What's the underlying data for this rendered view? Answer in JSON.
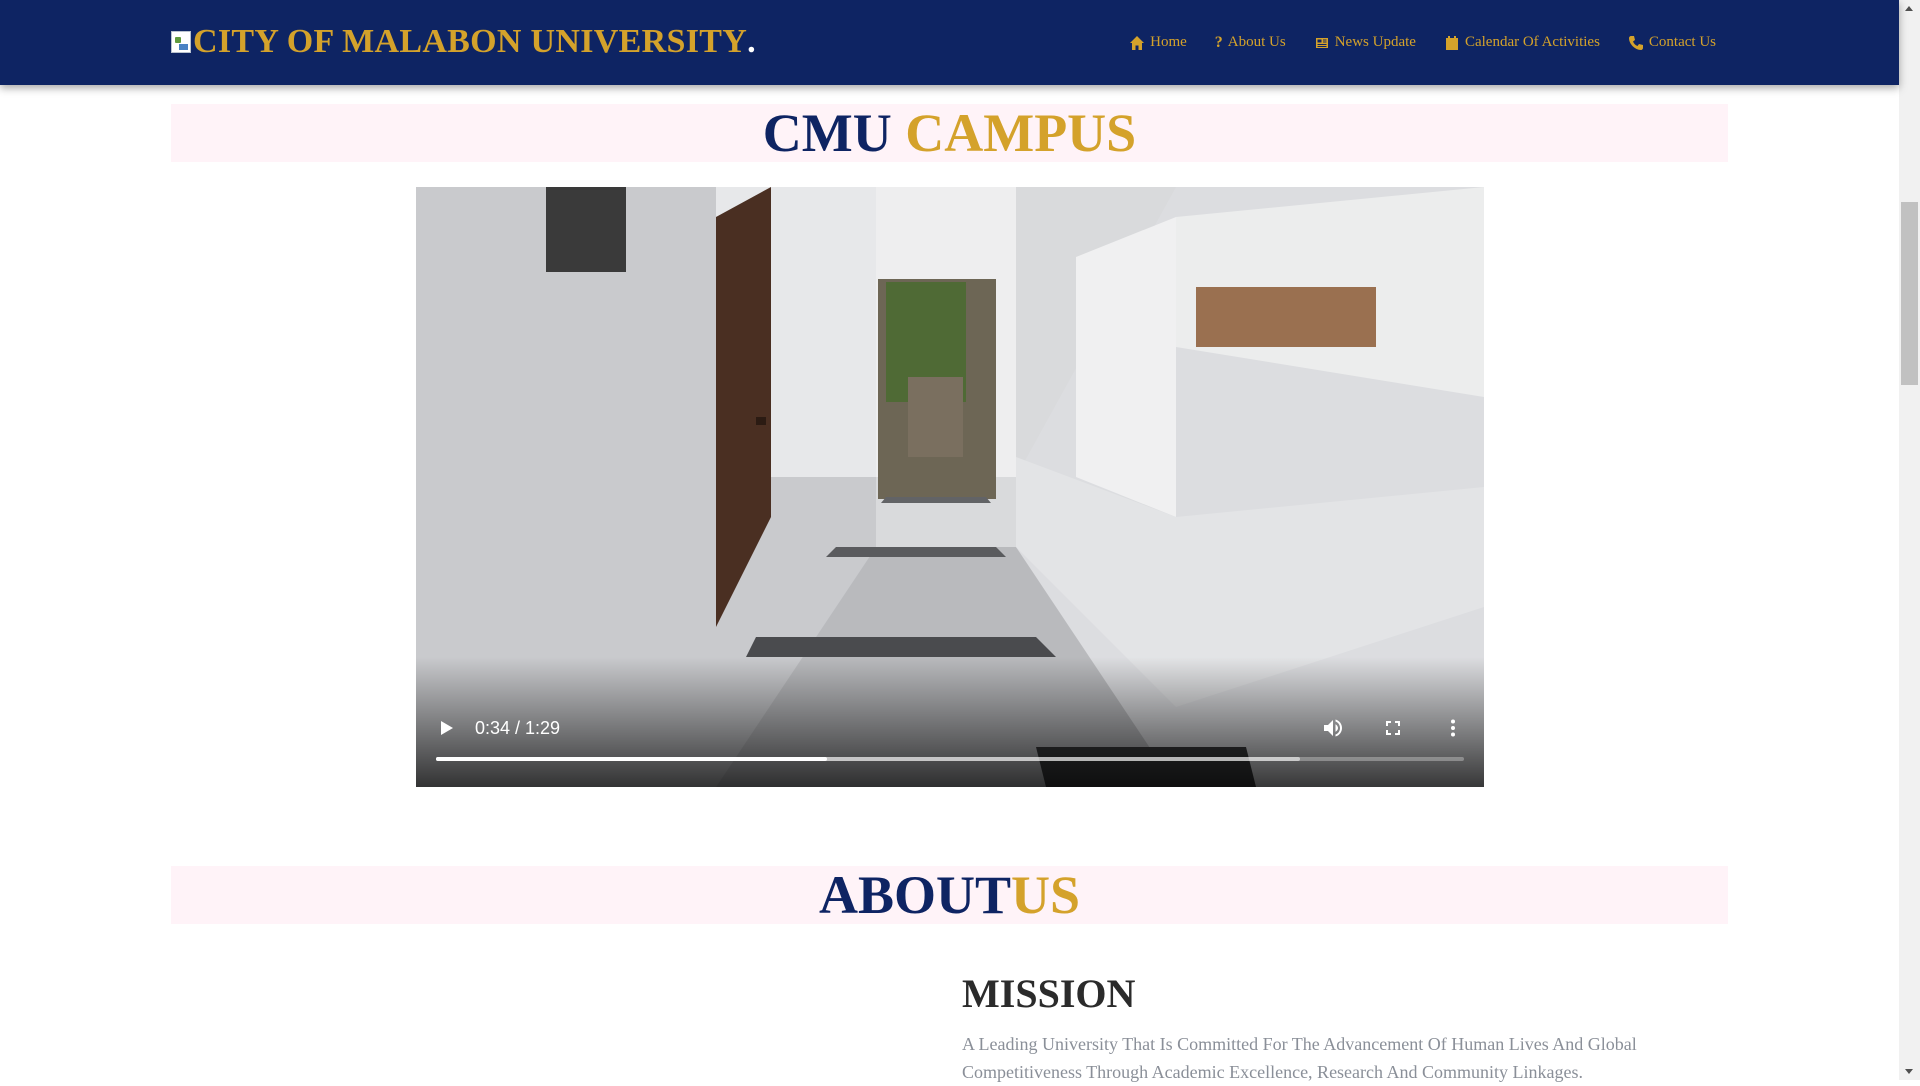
{
  "header": {
    "brand": "CITY OF MALABON UNIVERSITY",
    "brand_dot": ".",
    "nav": [
      {
        "label": "Home",
        "icon": "home-icon"
      },
      {
        "label": "About Us",
        "icon": "question-icon"
      },
      {
        "label": "News Update",
        "icon": "newspaper-icon"
      },
      {
        "label": "Calendar Of Activities",
        "icon": "calendar-icon"
      },
      {
        "label": "Contact Us",
        "icon": "phone-icon"
      }
    ]
  },
  "campus": {
    "title_part1": "CMU",
    "title_part2": "CAMPUS"
  },
  "video": {
    "time": "0:34 / 1:29",
    "played_fraction": 0.38,
    "buffered_fraction": 0.84
  },
  "about": {
    "title_part1": "ABOUT",
    "title_part2": "US"
  },
  "mission": {
    "heading": "MISSION",
    "text": "A Leading University That Is Committed For The Advancement Of Human Lives And Global Competitiveness Through Academic Excellence, Research And Community Linkages."
  },
  "colors": {
    "navy": "#0e2463",
    "gold": "#d4a22b",
    "title_band": "#fff3f8"
  }
}
